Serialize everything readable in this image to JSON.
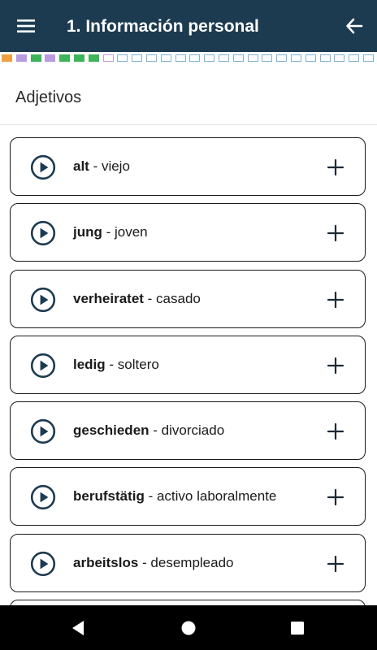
{
  "app_bar": {
    "title": "1. Información personal",
    "background": "#1c3b50",
    "menu_icon": "hamburger-menu-icon",
    "back_icon": "arrow-back-icon"
  },
  "progress": {
    "cells": [
      {
        "state": "done",
        "color": "#f0a040"
      },
      {
        "state": "done",
        "color": "#b89be0"
      },
      {
        "state": "done",
        "color": "#3db35a"
      },
      {
        "state": "done",
        "color": "#b89be0"
      },
      {
        "state": "done",
        "color": "#3db35a"
      },
      {
        "state": "done",
        "color": "#3db35a"
      },
      {
        "state": "done",
        "color": "#3db35a"
      },
      {
        "state": "pending",
        "color": "#c79ae0"
      },
      {
        "state": "pending",
        "color": "#7fb3d5"
      },
      {
        "state": "pending",
        "color": "#7fb3d5"
      },
      {
        "state": "pending",
        "color": "#7fb3d5"
      },
      {
        "state": "pending",
        "color": "#7fb3d5"
      },
      {
        "state": "pending",
        "color": "#7fb3d5"
      },
      {
        "state": "pending",
        "color": "#7fb3d5"
      },
      {
        "state": "pending",
        "color": "#7fb3d5"
      },
      {
        "state": "pending",
        "color": "#7fb3d5"
      },
      {
        "state": "pending",
        "color": "#7fb3d5"
      },
      {
        "state": "pending",
        "color": "#7fb3d5"
      },
      {
        "state": "pending",
        "color": "#7fb3d5"
      },
      {
        "state": "pending",
        "color": "#7fb3d5"
      },
      {
        "state": "pending",
        "color": "#7fb3d5"
      },
      {
        "state": "pending",
        "color": "#7fb3d5"
      },
      {
        "state": "pending",
        "color": "#7fb3d5"
      },
      {
        "state": "pending",
        "color": "#7fb3d5"
      },
      {
        "state": "pending",
        "color": "#7fb3d5"
      },
      {
        "state": "pending",
        "color": "#7fb3d5"
      }
    ]
  },
  "section": {
    "title": "Adjetivos"
  },
  "words": [
    {
      "de": "alt",
      "sep": " - ",
      "es": "viejo"
    },
    {
      "de": "jung",
      "sep": " - ",
      "es": "joven"
    },
    {
      "de": "verheiratet",
      "sep": " - ",
      "es": "casado"
    },
    {
      "de": "ledig",
      "sep": " - ",
      "es": "soltero"
    },
    {
      "de": "geschieden",
      "sep": " - ",
      "es": "divorciado"
    },
    {
      "de": "berufstätig",
      "sep": " - ",
      "es": "activo laboralmente"
    },
    {
      "de": "arbeitslos",
      "sep": " - ",
      "es": "desempleado"
    }
  ],
  "word_icons": {
    "play": "play-circle-icon",
    "add": "plus-icon"
  },
  "system_nav": {
    "back_icon": "triangle-back-icon",
    "home_icon": "circle-home-icon",
    "recents_icon": "square-recents-icon"
  },
  "colors": {
    "accent": "#1c3b50",
    "card_border": "#1a1a1a"
  }
}
